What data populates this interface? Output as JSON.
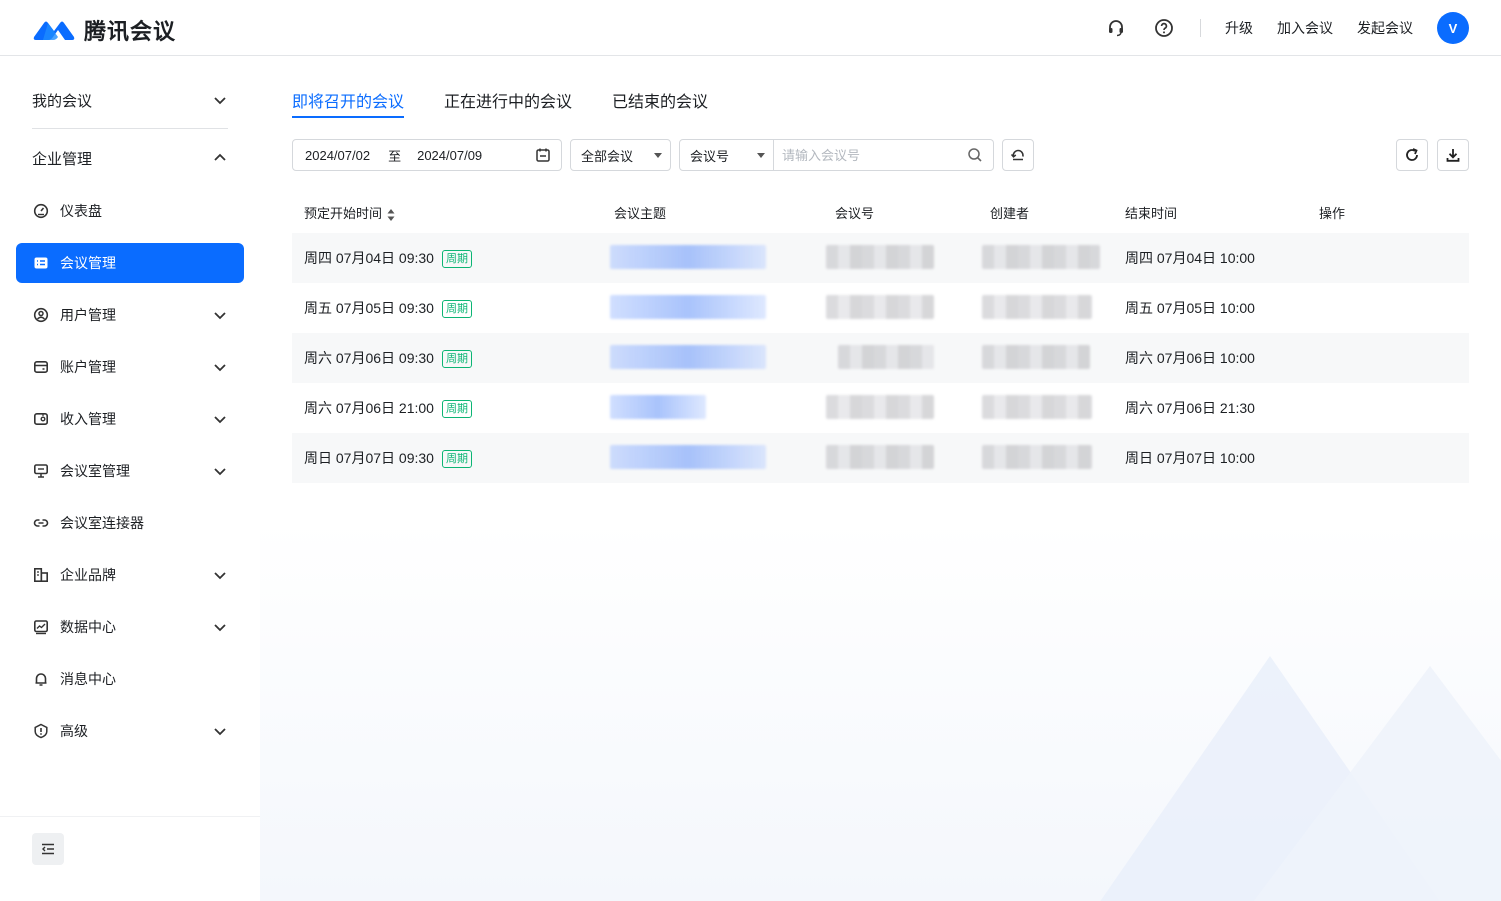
{
  "app": {
    "name": "腾讯会议"
  },
  "header": {
    "links": [
      "升级",
      "加入会议",
      "发起会议"
    ],
    "avatar_letter": "V",
    "icons": [
      "headset-icon",
      "help-icon"
    ]
  },
  "sidebar": {
    "sections": [
      {
        "label": "我的会议",
        "expanded": false
      },
      {
        "label": "企业管理",
        "expanded": true
      }
    ],
    "items": [
      {
        "label": "仪表盘",
        "icon": "dashboard-icon",
        "has_chevron": false,
        "active": false
      },
      {
        "label": "会议管理",
        "icon": "list-icon",
        "has_chevron": false,
        "active": true
      },
      {
        "label": "用户管理",
        "icon": "user-icon",
        "has_chevron": true,
        "active": false
      },
      {
        "label": "账户管理",
        "icon": "wallet-icon",
        "has_chevron": true,
        "active": false
      },
      {
        "label": "收入管理",
        "icon": "income-icon",
        "has_chevron": true,
        "active": false
      },
      {
        "label": "会议室管理",
        "icon": "room-icon",
        "has_chevron": true,
        "active": false
      },
      {
        "label": "会议室连接器",
        "icon": "link-icon",
        "has_chevron": false,
        "active": false
      },
      {
        "label": "企业品牌",
        "icon": "brand-icon",
        "has_chevron": true,
        "active": false
      },
      {
        "label": "数据中心",
        "icon": "chart-icon",
        "has_chevron": true,
        "active": false
      },
      {
        "label": "消息中心",
        "icon": "bell-icon",
        "has_chevron": false,
        "active": false
      },
      {
        "label": "高级",
        "icon": "shield-icon",
        "has_chevron": true,
        "active": false
      }
    ]
  },
  "tabs": [
    {
      "label": "即将召开的会议",
      "active": true
    },
    {
      "label": "正在进行中的会议",
      "active": false
    },
    {
      "label": "已结束的会议",
      "active": false
    }
  ],
  "filters": {
    "date_start": "2024/07/02",
    "date_sep": "至",
    "date_end": "2024/07/09",
    "meeting_type": "全部会议",
    "search_field": "会议号",
    "search_placeholder": "请输入会议号"
  },
  "table": {
    "columns": [
      "预定开始时间",
      "会议主题",
      "会议号",
      "创建者",
      "结束时间",
      "操作"
    ],
    "rows": [
      {
        "start": "周四 07月04日  09:30",
        "badge": "周期",
        "end": "周四 07月04日   10:00"
      },
      {
        "start": "周五 07月05日  09:30",
        "badge": "周期",
        "end": "周五 07月05日   10:00"
      },
      {
        "start": "周六 07月06日  09:30",
        "badge": "周期",
        "end": "周六 07月06日   10:00"
      },
      {
        "start": "周六 07月06日  21:00",
        "badge": "周期",
        "end": "周六 07月06日   21:30"
      },
      {
        "start": "周日 07月07日  09:30",
        "badge": "周期",
        "end": "周日 07月07日   10:00"
      }
    ]
  },
  "colors": {
    "accent": "#0a6cff",
    "badge_green": "#0bb574",
    "stripe": "#f7f8f9"
  }
}
